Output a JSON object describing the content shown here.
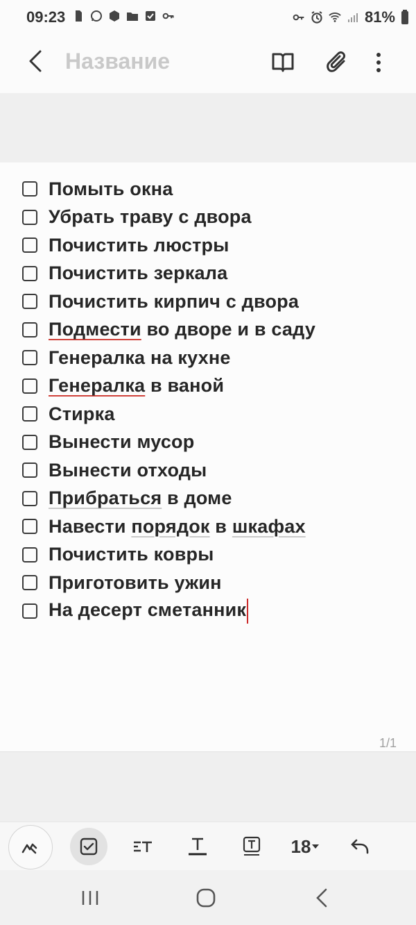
{
  "status": {
    "time": "09:23",
    "battery": "81%"
  },
  "header": {
    "title_placeholder": "Название"
  },
  "checklist": [
    {
      "label": "Помыть окна"
    },
    {
      "label": "Убрать траву с двора"
    },
    {
      "label": "Почистить люстры"
    },
    {
      "label": "Почистить зеркала"
    },
    {
      "label": "Почистить кирпич с двора"
    },
    {
      "pre": "",
      "marked": "Подмести",
      "post": " во дворе и в саду"
    },
    {
      "label": "Генералка на кухне"
    },
    {
      "pre": "",
      "marked": "Генералка",
      "post": " в ваной"
    },
    {
      "label": "Стирка"
    },
    {
      "label": "Вынести мусор"
    },
    {
      "label": "Вынести отходы"
    },
    {
      "label": "Прибраться в доме"
    },
    {
      "label": "Навести порядок в шкафах"
    },
    {
      "label": "Почистить ковры"
    },
    {
      "label": "Приготовить ужин"
    },
    {
      "label": "На десерт сметанник"
    }
  ],
  "page_indicator": "1/1",
  "toolbar": {
    "font_size": "18"
  },
  "colors": {
    "spell_error_underline": "#d0413a",
    "suggestion_underline": "#c9c9c9",
    "caret": "#cc2a2a"
  }
}
